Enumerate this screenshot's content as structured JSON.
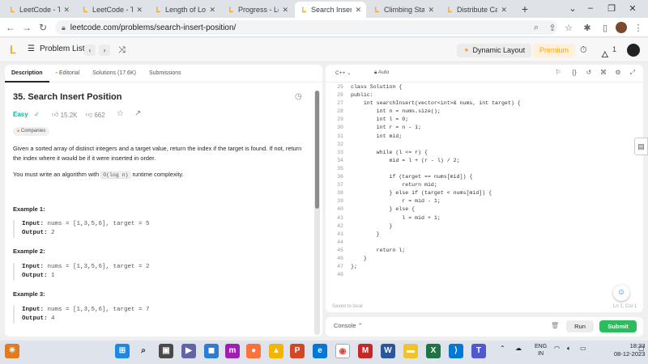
{
  "browser": {
    "tabs": [
      {
        "title": "LeetCode - The",
        "icon": "leetcode-icon"
      },
      {
        "title": "LeetCode - The",
        "icon": "leetcode-icon"
      },
      {
        "title": "Length of Lon",
        "icon": "leetcode-icon"
      },
      {
        "title": "Progress - Lee",
        "icon": "leetcode-icon"
      },
      {
        "title": "Search Insert",
        "icon": "leetcode-icon"
      },
      {
        "title": "Climbing Stair",
        "icon": "leetcode-icon"
      },
      {
        "title": "Distribute Can",
        "icon": "leetcode-icon"
      }
    ],
    "url": "leetcode.com/problems/search-insert-position/"
  },
  "header": {
    "problem_list": "Problem List",
    "dynamic_layout": "Dynamic Layout",
    "premium": "Premium",
    "streak": "1"
  },
  "left": {
    "tabs": [
      "Description",
      "Editorial",
      "Solutions (17.6K)",
      "Submissions"
    ],
    "title": "35. Search Insert Position",
    "difficulty": "Easy",
    "likes": "15.2K",
    "dislikes": "662",
    "companies": "Companies",
    "desc1": "Given a sorted array of distinct integers and a target value, return the index if the target is found. If not, return the index where it would be if it were inserted in order.",
    "desc2_pre": "You must write an algorithm with",
    "desc2_code": "O(log n)",
    "desc2_post": "runtime complexity.",
    "examples": [
      {
        "title": "Example 1:",
        "input_label": "Input:",
        "input": "nums = [1,3,5,6], target = 5",
        "output_label": "Output:",
        "output": "2"
      },
      {
        "title": "Example 2:",
        "input_label": "Input:",
        "input": "nums = [1,3,5,6], target = 2",
        "output_label": "Output:",
        "output": "1"
      },
      {
        "title": "Example 3:",
        "input_label": "Input:",
        "input": "nums = [1,3,5,6], target = 7",
        "output_label": "Output:",
        "output": "4"
      }
    ]
  },
  "editor": {
    "language": "C++",
    "auto": "Auto",
    "saved": "Saved to local",
    "cursor": "Ln 1, Col 1",
    "first_line": 25,
    "lines": [
      "class Solution {",
      "public:",
      "    int searchInsert(vector<int>& nums, int target) {",
      "        int n = nums.size();",
      "        int l = 0;",
      "        int r = n - 1;",
      "        int mid;",
      "",
      "        while (l <= r) {",
      "            mid = l + (r - l) / 2;",
      "",
      "            if (target == nums[mid]) {",
      "                return mid;",
      "            } else if (target < nums[mid]) {",
      "                r = mid - 1;",
      "            } else {",
      "                l = mid + 1;",
      "            }",
      "        }",
      "",
      "        return l;",
      "    }",
      "};",
      ""
    ]
  },
  "console": {
    "label": "Console",
    "run": "Run",
    "submit": "Submit"
  },
  "taskbar": {
    "lang_top": "ENG",
    "lang_bottom": "IN",
    "time": "18:33",
    "date": "08-12-2023"
  }
}
